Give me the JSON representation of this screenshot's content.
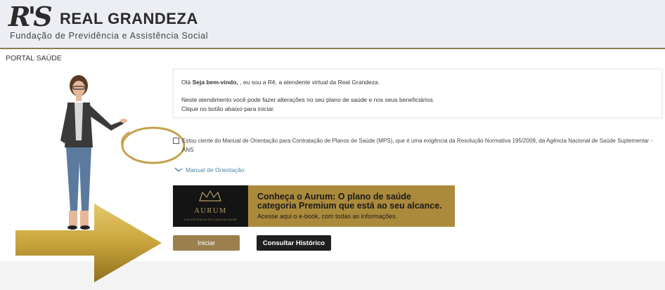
{
  "header": {
    "logo_mark": "R'S",
    "brand_name": "REAL GRANDEZA",
    "brand_subtitle": "Fundação de Previdência e Assistência Social"
  },
  "page_title": "PORTAL SAÚDE",
  "chat": {
    "greeting_prefix": "Olá",
    "greeting_bold": "Seja bem-vindo,",
    "greeting_rest": ", eu sou a Rê, a atendente virtual da Real Grandeza.",
    "line2": "Neste atendimento você pode fazer alterações no seu plano de saúde e nos seus beneficiários.",
    "line3": "Clique no botão abaixo para iniciar."
  },
  "consent": {
    "line1": "Estou ciente do Manual de Orientação para Contratação de Planos de Saúde (MPS), que é uma exigência da Resolução Normativa 195/2009, da Agência Nacional de Saúde Suplementar -",
    "line2": "ANS",
    "checked": false
  },
  "manual_link": "Manual de Orientação",
  "banner": {
    "aurum": "AURUM",
    "tagline": "A EXCELÊNCIA EM CADA DETALHE",
    "headline1": "Conheça o Aurum: O plano de saúde",
    "headline2": "categoria Premium que está ao seu alcance.",
    "subtitle": "Acesse aqui o e-book, com todas as informações."
  },
  "buttons": {
    "start": "Iniciar",
    "history": "Consultar Histórico"
  },
  "colors": {
    "header_bg": "#eceef4",
    "gold": "#ac8a3c",
    "start_button": "#9b7f4c",
    "history_button": "#1f1f1f",
    "link": "#4a86a8"
  }
}
